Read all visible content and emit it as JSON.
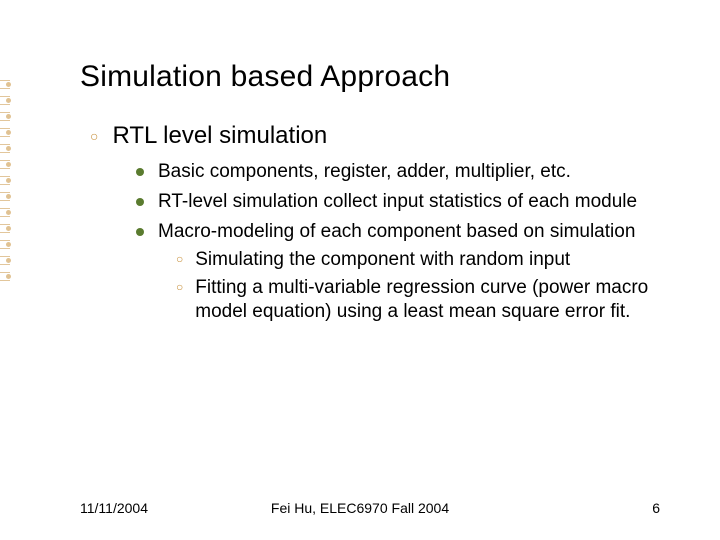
{
  "title": "Simulation based Approach",
  "level1": {
    "text": "RTL level simulation"
  },
  "level2": [
    {
      "text": "Basic components, register, adder, multiplier, etc."
    },
    {
      "text": "RT-level simulation collect input statistics of each module"
    },
    {
      "text": "Macro-modeling of each component based on simulation"
    }
  ],
  "level3": [
    {
      "text": "Simulating the component with random input"
    },
    {
      "text": "Fitting a multi-variable regression curve (power macro model equation) using a least mean square error fit."
    }
  ],
  "footer": {
    "date": "11/11/2004",
    "center": "Fei Hu, ELEC6970 Fall 2004",
    "page": "6"
  }
}
